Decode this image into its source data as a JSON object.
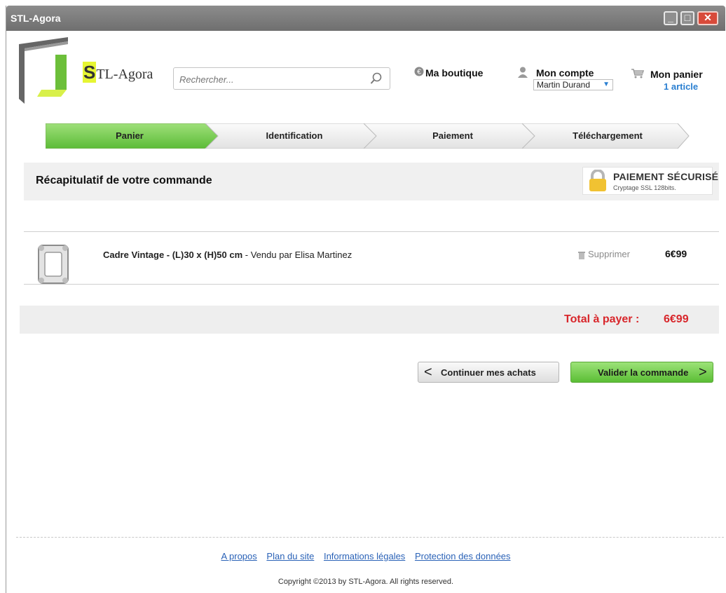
{
  "window": {
    "title": "STL-Agora"
  },
  "header": {
    "logo_letter": "S",
    "logo_rest": "TL-Agora",
    "search_placeholder": "Rechercher...",
    "shop_label": "Ma boutique",
    "account_label": "Mon compte",
    "account_user": "Martin Durand",
    "cart_label": "Mon panier",
    "cart_count": "1 article"
  },
  "steps": [
    {
      "label": "Panier",
      "active": true
    },
    {
      "label": "Identification",
      "active": false
    },
    {
      "label": "Paiement",
      "active": false
    },
    {
      "label": "Téléchargement",
      "active": false
    }
  ],
  "summary": {
    "title": "Récapitulatif de votre commande",
    "secure_title": "PAIEMENT SÉCURISÉ",
    "secure_subtitle": "Cryptage SSL 128bits."
  },
  "cart_items": [
    {
      "name": "Cadre Vintage - (L)30 x (H)50 cm",
      "seller": " - Vendu par Elisa Martinez",
      "delete_label": "Supprimer",
      "price": "6€99"
    }
  ],
  "total": {
    "label": "Total à payer :",
    "value": "6€99"
  },
  "actions": {
    "continue_label": "Continuer mes achats",
    "validate_label": "Valider la commande"
  },
  "footer": {
    "links": [
      "A propos",
      "Plan du site",
      "Informations légales",
      "Protection des données"
    ],
    "copyright": "Copyright ©2013 by STL-Agora. All rights reserved."
  },
  "colors": {
    "accent_green": "#5bbe35",
    "link_blue": "#2a62b7",
    "total_red": "#d8262b"
  }
}
